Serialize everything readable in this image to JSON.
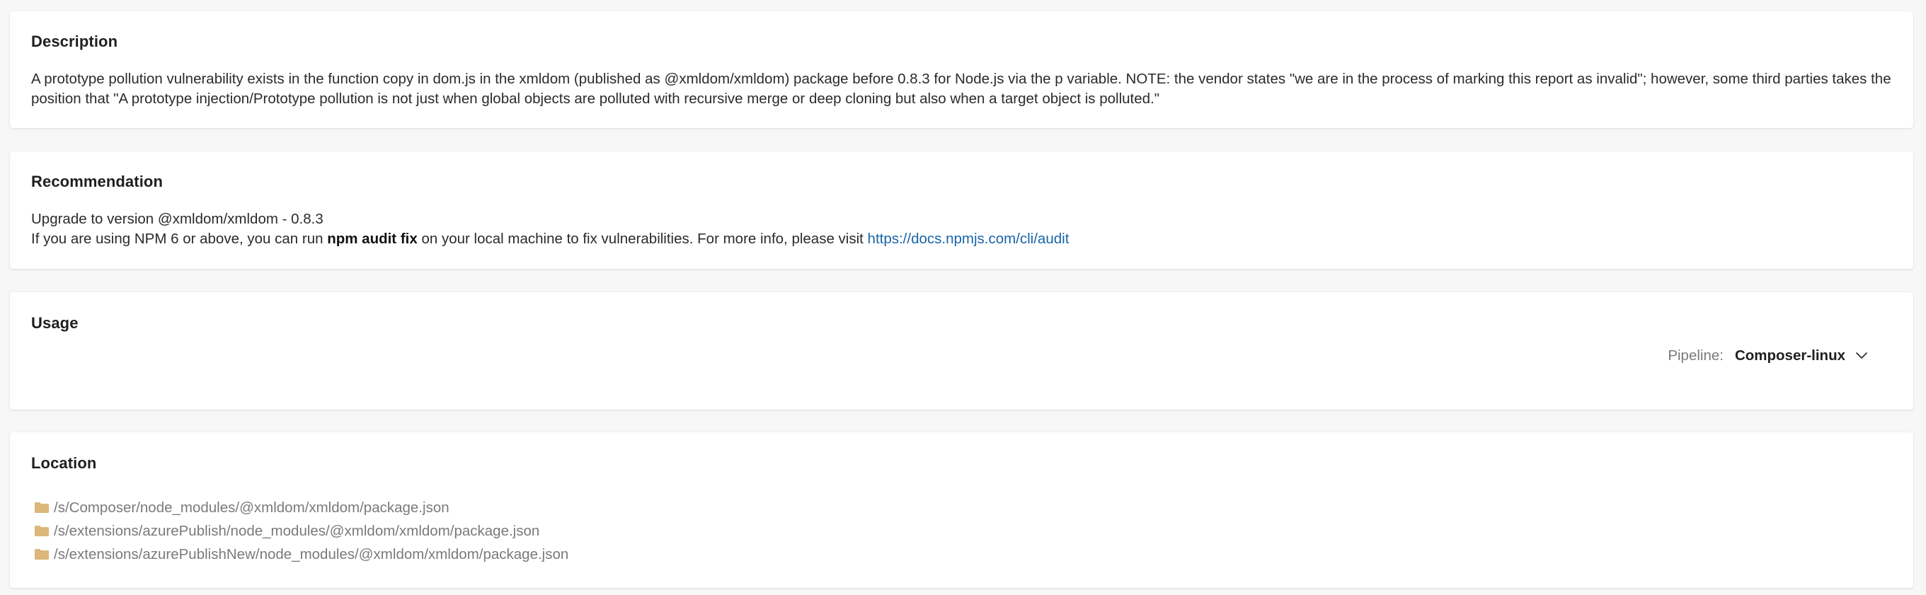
{
  "description": {
    "title": "Description",
    "text": "A prototype pollution vulnerability exists in the function copy in dom.js in the xmldom (published as @xmldom/xmldom) package before 0.8.3 for Node.js via the p variable. NOTE: the vendor states \"we are in the process of marking this report as invalid\"; however, some third parties takes the position that \"A prototype injection/Prototype pollution is not just when global objects are polluted with recursive merge or deep cloning but also when a target object is polluted.\""
  },
  "recommendation": {
    "title": "Recommendation",
    "upgrade_text": "Upgrade to version @xmldom/xmldom - 0.8.3",
    "npm_prefix": "If you are using NPM 6 or above, you can run ",
    "npm_command": "npm audit fix",
    "npm_suffix": " on your local machine to fix vulnerabilities. For more info, please visit ",
    "link_text": "https://docs.npmjs.com/cli/audit"
  },
  "usage": {
    "title": "Usage",
    "pipeline_label": "Pipeline:",
    "pipeline_value": "Composer-linux"
  },
  "location": {
    "title": "Location",
    "paths": [
      "/s/Composer/node_modules/@xmldom/xmldom/package.json",
      "/s/extensions/azurePublish/node_modules/@xmldom/xmldom/package.json",
      "/s/extensions/azurePublishNew/node_modules/@xmldom/xmldom/package.json"
    ]
  },
  "colors": {
    "link": "#1a64a8",
    "folder": "#dcb67a",
    "muted_text": "#7a7a7a"
  }
}
